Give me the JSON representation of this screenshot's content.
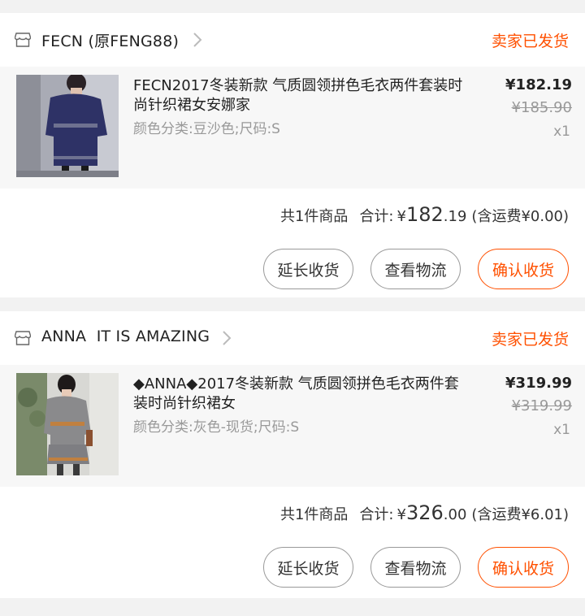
{
  "orders": [
    {
      "shop_name": "FECN (原FENG88)",
      "status": "卖家已发货",
      "item": {
        "title": "FECN2017冬装新款 气质圆领拼色毛衣两件套装时尚针织裙女安娜家",
        "sku": "颜色分类:豆沙色;尺码:S",
        "price": "¥182.19",
        "original_price": "¥185.90",
        "quantity": "x1"
      },
      "summary": {
        "count_text": "共1件商品",
        "total_label": "合计:",
        "currency": "¥",
        "total_int": "182",
        "total_dec": ".19",
        "shipping": "(含运费¥0.00)"
      },
      "buttons": {
        "extend": "延长收货",
        "track": "查看物流",
        "confirm": "确认收货"
      }
    },
    {
      "shop_name": "ANNA  IT IS AMAZING",
      "status": "卖家已发货",
      "item": {
        "title": "◆ANNA◆2017冬装新款 气质圆领拼色毛衣两件套装时尚针织裙女",
        "sku": "颜色分类:灰色-现货;尺码:S",
        "price": "¥319.99",
        "original_price": "¥319.99",
        "quantity": "x1"
      },
      "summary": {
        "count_text": "共1件商品",
        "total_label": "合计:",
        "currency": "¥",
        "total_int": "326",
        "total_dec": ".00",
        "shipping": "(含运费¥6.01)"
      },
      "buttons": {
        "extend": "延长收货",
        "track": "查看物流",
        "confirm": "确认收货"
      }
    }
  ],
  "colors": {
    "accent": "#ff5000",
    "muted": "#999999",
    "item_bg": "#f7f7f7",
    "page_bg": "#f2f2f2"
  },
  "icons": {
    "store": "store-icon",
    "chevron": "chevron-right-icon"
  }
}
